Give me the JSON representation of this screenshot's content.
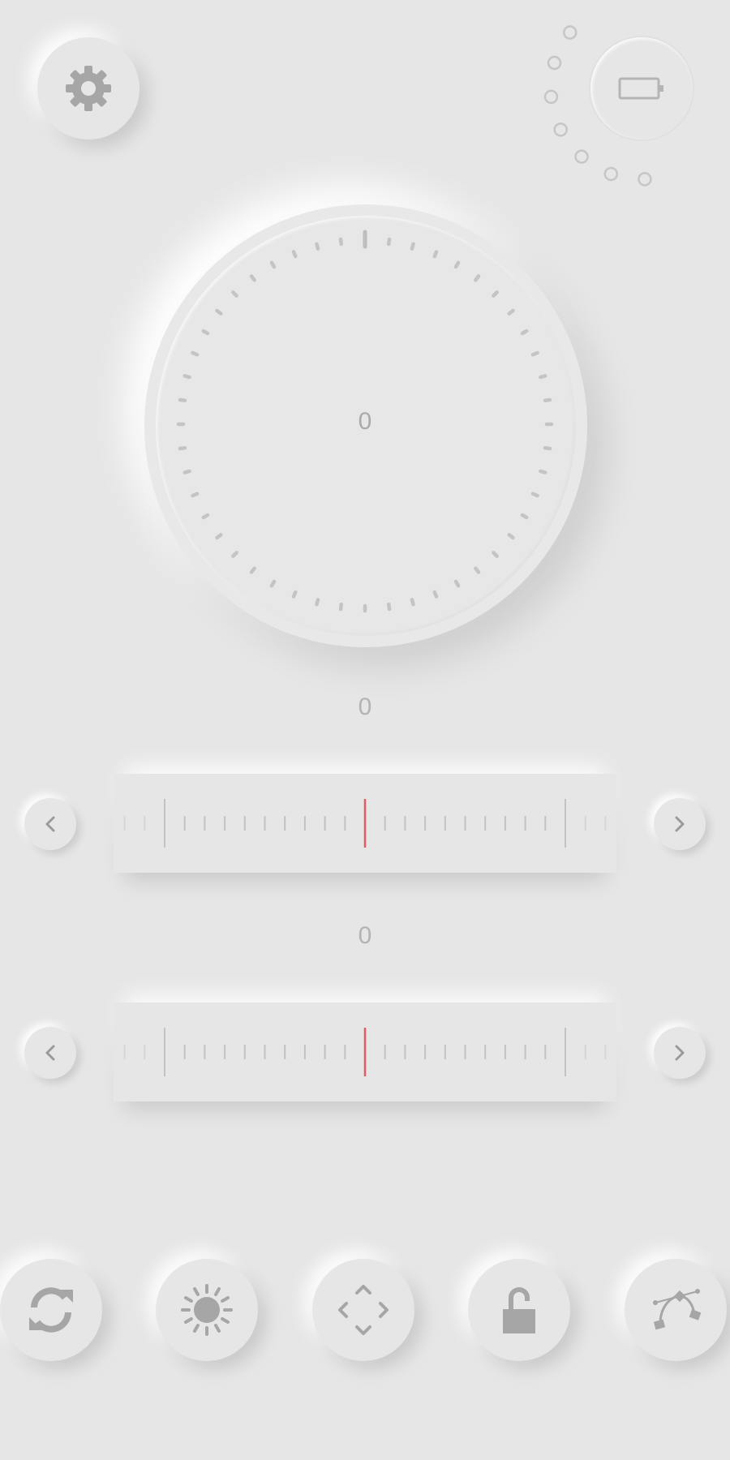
{
  "top_bar": {
    "settings_icon": "gear-icon",
    "battery_icon": "battery-icon",
    "battery_level_dots": 7
  },
  "dial": {
    "value": "0",
    "tick_count": 48
  },
  "sliders": [
    {
      "value": "0",
      "prev_icon": "chevron-left-icon",
      "next_icon": "chevron-right-icon",
      "position": 0.5
    },
    {
      "value": "0",
      "prev_icon": "chevron-left-icon",
      "next_icon": "chevron-right-icon",
      "position": 0.5
    }
  ],
  "toolbar": {
    "buttons": [
      {
        "icon": "sync-icon"
      },
      {
        "icon": "brightness-icon"
      },
      {
        "icon": "move-arrows-icon"
      },
      {
        "icon": "unlock-icon"
      },
      {
        "icon": "bezier-curve-icon"
      }
    ]
  },
  "colors": {
    "background": "#e6e6e6",
    "icon": "#a6a6a6",
    "tick": "#c4c4c4",
    "indicator": "#e45a61"
  }
}
